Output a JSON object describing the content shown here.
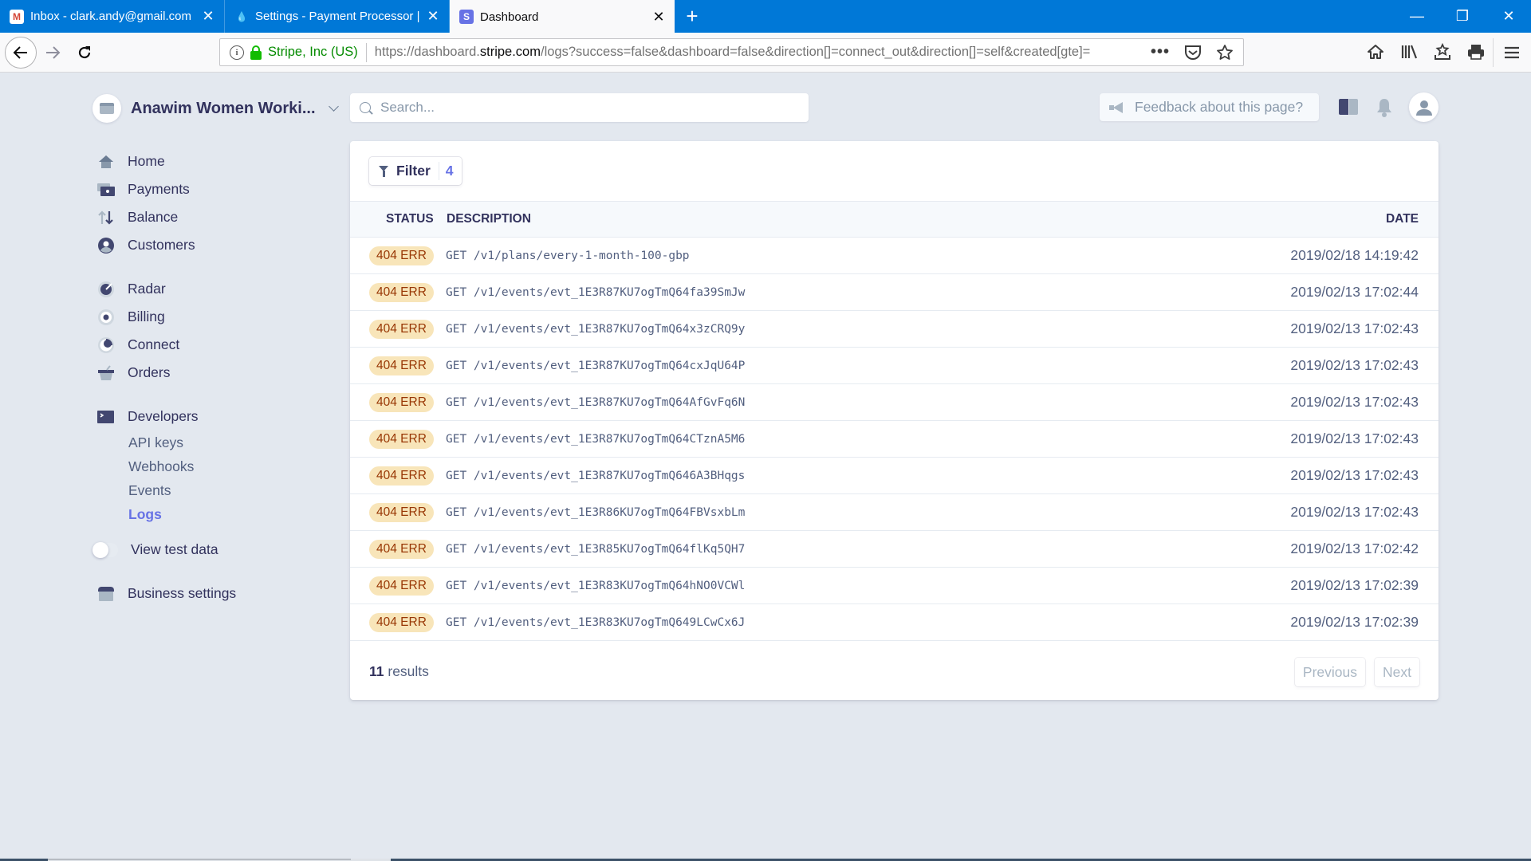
{
  "browser": {
    "tabs": [
      {
        "title": "Inbox - clark.andy@gmail.com",
        "icon": "gmail-icon",
        "active": false
      },
      {
        "title": "Settings - Payment Processor | C",
        "icon": "drupal-icon",
        "active": false
      },
      {
        "title": "Dashboard",
        "icon": "stripe-icon",
        "active": true
      }
    ],
    "new_tab_label": "+",
    "window_controls": {
      "minimize": "—",
      "restore": "❐",
      "close": "✕"
    },
    "url": {
      "org": "Stripe, Inc (US)",
      "prefix": "https://dashboard.",
      "domain": "stripe.com",
      "path": "/logs?success=false&dashboard=false&direction[]=connect_out&direction[]=self&created[gte]="
    },
    "url_actions": [
      "more-icon",
      "pocket-icon",
      "bookmark-star-icon"
    ],
    "toolbar_icons": [
      "home-icon",
      "library-icon",
      "bookmarks-menu-icon",
      "print-icon"
    ]
  },
  "account": {
    "name": "Anawim Women Worki..."
  },
  "search": {
    "placeholder": "Search..."
  },
  "feedback": {
    "label": "Feedback about this page?"
  },
  "sidebar": {
    "groups": [
      [
        {
          "label": "Home",
          "icon": "home-icon"
        },
        {
          "label": "Payments",
          "icon": "payments-icon"
        },
        {
          "label": "Balance",
          "icon": "balance-icon"
        },
        {
          "label": "Customers",
          "icon": "customers-icon"
        }
      ],
      [
        {
          "label": "Radar",
          "icon": "radar-icon"
        },
        {
          "label": "Billing",
          "icon": "billing-icon"
        },
        {
          "label": "Connect",
          "icon": "connect-icon"
        },
        {
          "label": "Orders",
          "icon": "orders-icon"
        }
      ]
    ],
    "developers": {
      "label": "Developers",
      "items": [
        {
          "label": "API keys",
          "active": false
        },
        {
          "label": "Webhooks",
          "active": false
        },
        {
          "label": "Events",
          "active": false
        },
        {
          "label": "Logs",
          "active": true
        }
      ]
    },
    "test_data": {
      "label": "View test data",
      "on": false
    },
    "business_settings": {
      "label": "Business settings"
    }
  },
  "filter": {
    "label": "Filter",
    "count": "4"
  },
  "table": {
    "columns": {
      "status": "STATUS",
      "description": "DESCRIPTION",
      "date": "DATE"
    },
    "rows": [
      {
        "status": "404 ERR",
        "description": "GET /v1/plans/every-1-month-100-gbp",
        "date": "2019/02/18 14:19:42"
      },
      {
        "status": "404 ERR",
        "description": "GET /v1/events/evt_1E3R87KU7ogTmQ64fa39SmJw",
        "date": "2019/02/13 17:02:44"
      },
      {
        "status": "404 ERR",
        "description": "GET /v1/events/evt_1E3R87KU7ogTmQ64x3zCRQ9y",
        "date": "2019/02/13 17:02:43"
      },
      {
        "status": "404 ERR",
        "description": "GET /v1/events/evt_1E3R87KU7ogTmQ64cxJqU64P",
        "date": "2019/02/13 17:02:43"
      },
      {
        "status": "404 ERR",
        "description": "GET /v1/events/evt_1E3R87KU7ogTmQ64AfGvFq6N",
        "date": "2019/02/13 17:02:43"
      },
      {
        "status": "404 ERR",
        "description": "GET /v1/events/evt_1E3R87KU7ogTmQ64CTznA5M6",
        "date": "2019/02/13 17:02:43"
      },
      {
        "status": "404 ERR",
        "description": "GET /v1/events/evt_1E3R87KU7ogTmQ646A3BHqgs",
        "date": "2019/02/13 17:02:43"
      },
      {
        "status": "404 ERR",
        "description": "GET /v1/events/evt_1E3R86KU7ogTmQ64FBVsxbLm",
        "date": "2019/02/13 17:02:43"
      },
      {
        "status": "404 ERR",
        "description": "GET /v1/events/evt_1E3R85KU7ogTmQ64flKq5QH7",
        "date": "2019/02/13 17:02:42"
      },
      {
        "status": "404 ERR",
        "description": "GET /v1/events/evt_1E3R83KU7ogTmQ64hNO0VCWl",
        "date": "2019/02/13 17:02:39"
      },
      {
        "status": "404 ERR",
        "description": "GET /v1/events/evt_1E3R83KU7ogTmQ649LCwCx6J",
        "date": "2019/02/13 17:02:39"
      }
    ]
  },
  "footer": {
    "count": "11",
    "results_label": "results",
    "previous": "Previous",
    "next": "Next"
  },
  "colors": {
    "tabbar": "#0078d7",
    "page_bg": "#e3e8ef",
    "accent": "#6772e5",
    "badge_bg": "#f8e5b9",
    "badge_text": "#983705",
    "secure_green": "#058b00"
  }
}
